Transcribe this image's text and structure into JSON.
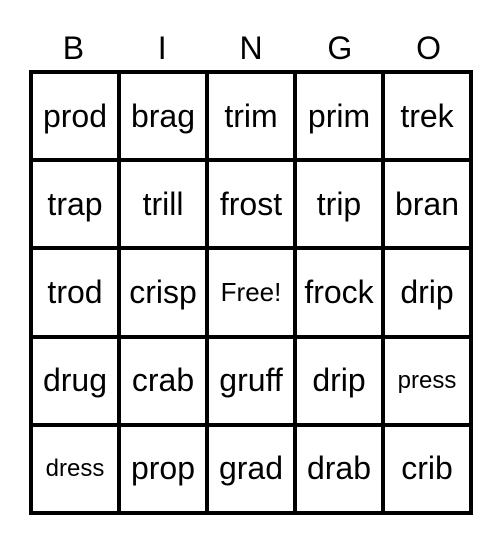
{
  "header": [
    "B",
    "I",
    "N",
    "G",
    "O"
  ],
  "cells": [
    [
      "prod",
      "brag",
      "trim",
      "prim",
      "trek"
    ],
    [
      "trap",
      "trill",
      "frost",
      "trip",
      "bran"
    ],
    [
      "trod",
      "crisp",
      "Free!",
      "frock",
      "drip"
    ],
    [
      "drug",
      "crab",
      "gruff",
      "drip",
      "press"
    ],
    [
      "dress",
      "prop",
      "grad",
      "drab",
      "crib"
    ]
  ]
}
